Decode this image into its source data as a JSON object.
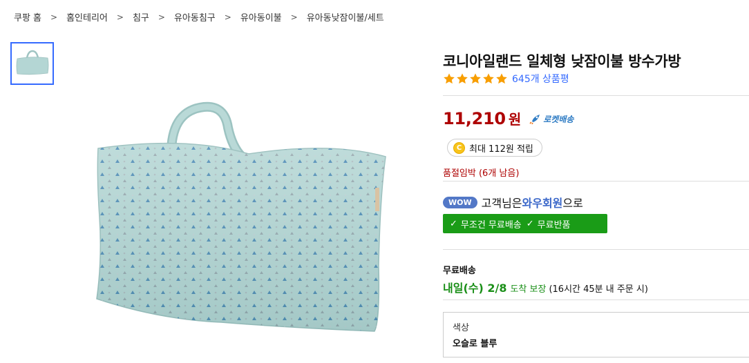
{
  "breadcrumb": [
    "쿠팡 홈",
    "홈인테리어",
    "침구",
    "유아동침구",
    "유아동이불",
    "유아동낮잠이불/세트"
  ],
  "breadcrumb_separator": ">",
  "product": {
    "title": "코니아일랜드 일체형 낮잠이불 방수가방",
    "rating_value": 5,
    "rating_max": 5,
    "review_count": "645개 상품평",
    "price": "11,210",
    "currency": "원",
    "delivery_badge": "로켓배송",
    "points": "최대 112원 적립",
    "points_coin": "C",
    "stock_notice": "품절임박 (6개 남음)"
  },
  "wow": {
    "badge": "WOW",
    "prefix": "고객님은 ",
    "strong": "와우회원",
    "suffix": "으로",
    "benefits": [
      "무조건 무료배송",
      "무료반품"
    ]
  },
  "shipping": {
    "label": "무료배송",
    "date": "내일(수) 2/8",
    "guarantee": "도착 보장",
    "note": "(16시간 45분 내 주문 시)"
  },
  "option": {
    "label": "색상",
    "value": "오슬로 블루"
  },
  "colors": {
    "accent": "#346aff",
    "price": "#ae0000",
    "green": "#1a9c17",
    "star": "#f89e00",
    "pillow": "#b4d6d4"
  }
}
